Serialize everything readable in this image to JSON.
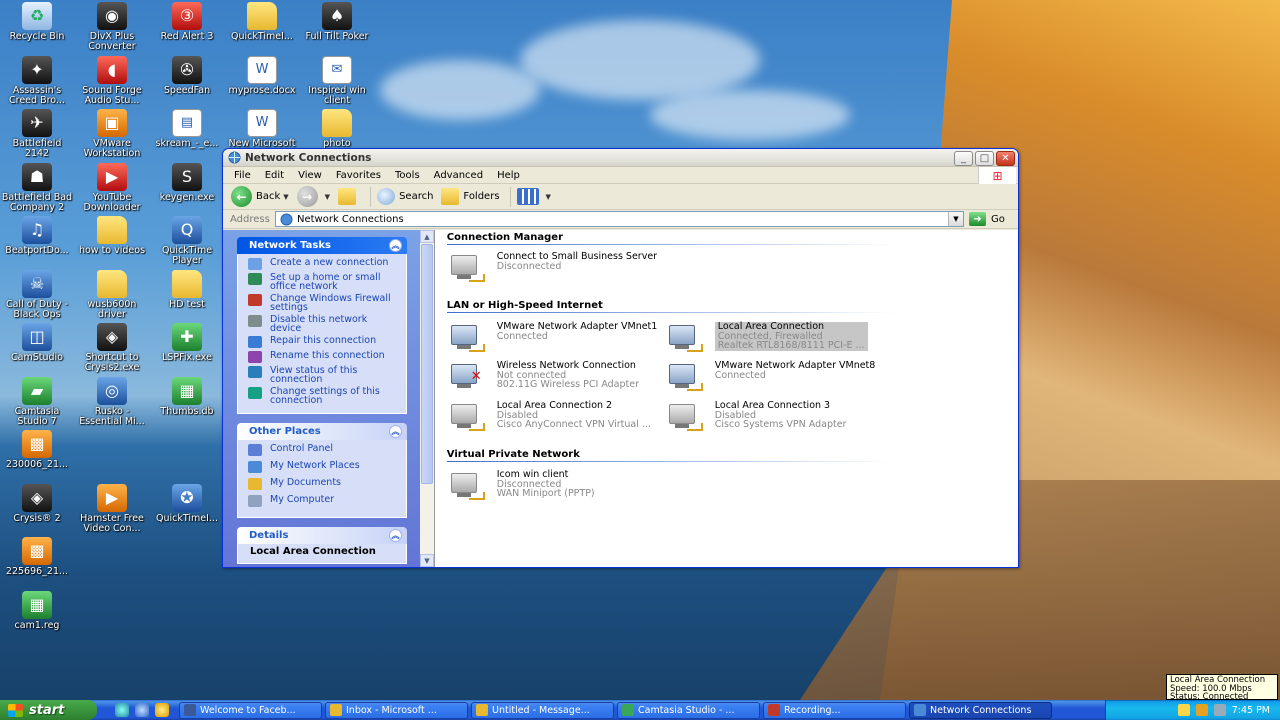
{
  "desktop_icons": [
    {
      "label": "Recycle Bin",
      "style": "recycle",
      "glyph": "♻"
    },
    {
      "label": "DivX Plus Converter",
      "style": "dark",
      "glyph": "◉"
    },
    {
      "label": "Red Alert 3",
      "style": "red",
      "glyph": "③"
    },
    {
      "label": "QuickTimeI...",
      "style": "folder",
      "glyph": ""
    },
    {
      "label": "Full Tilt Poker",
      "style": "dark",
      "glyph": "♠"
    },
    {
      "label": "Assassin's Creed Bro...",
      "style": "dark",
      "glyph": "✦"
    },
    {
      "label": "Sound Forge Audio Stu...",
      "style": "red",
      "glyph": "◖"
    },
    {
      "label": "SpeedFan",
      "style": "dark",
      "glyph": "✇"
    },
    {
      "label": "myprose.docx",
      "style": "doc",
      "glyph": "W"
    },
    {
      "label": "Inspired win client",
      "style": "doc",
      "glyph": "✉"
    },
    {
      "label": "Battlefield 2142",
      "style": "dark",
      "glyph": "✈"
    },
    {
      "label": "VMware Workstation",
      "style": "orange",
      "glyph": "▣"
    },
    {
      "label": "skream_-_e...",
      "style": "doc",
      "glyph": "▤"
    },
    {
      "label": "New Microsoft Office Wo...",
      "style": "doc",
      "glyph": "W"
    },
    {
      "label": "photo",
      "style": "folder",
      "glyph": ""
    },
    {
      "label": "Battlefield Bad Company 2",
      "style": "dark",
      "glyph": "☗"
    },
    {
      "label": "YouTube Downloader",
      "style": "red",
      "glyph": "▶"
    },
    {
      "label": "keygen.exe",
      "style": "dark",
      "glyph": "S"
    },
    {
      "label": "BeatportDo...",
      "style": "app",
      "glyph": "♫"
    },
    {
      "label": "how to videos",
      "style": "folder",
      "glyph": ""
    },
    {
      "label": "QuickTime Player",
      "style": "app",
      "glyph": "Q"
    },
    {
      "label": "Call of Duty - Black Ops",
      "style": "app",
      "glyph": "☠"
    },
    {
      "label": "wusb600n driver",
      "style": "folder",
      "glyph": ""
    },
    {
      "label": "HD test",
      "style": "folder",
      "glyph": ""
    },
    {
      "label": "CamStudio",
      "style": "app",
      "glyph": "◫"
    },
    {
      "label": "Shortcut to Crysis2.exe",
      "style": "dark",
      "glyph": "◈"
    },
    {
      "label": "LSPFix.exe",
      "style": "green",
      "glyph": "✚"
    },
    {
      "label": "Camtasia Studio 7",
      "style": "green",
      "glyph": "▰"
    },
    {
      "label": "Rusko - Essential Mi...",
      "style": "app",
      "glyph": "◎"
    },
    {
      "label": "Thumbs.db",
      "style": "green",
      "glyph": "▦"
    },
    {
      "label": "230006_21...",
      "style": "orange",
      "glyph": "▩"
    },
    {
      "label": "Crysis® 2",
      "style": "dark",
      "glyph": "◈"
    },
    {
      "label": "Hamster Free Video Con...",
      "style": "orange",
      "glyph": "▶"
    },
    {
      "label": "QuickTimeI...",
      "style": "app",
      "glyph": "✪"
    },
    {
      "label": "225696_21...",
      "style": "orange",
      "glyph": "▩"
    },
    {
      "label": "cam1.reg",
      "style": "green",
      "glyph": "▦"
    }
  ],
  "window": {
    "title": "Network Connections",
    "menu": [
      "File",
      "Edit",
      "View",
      "Favorites",
      "Tools",
      "Advanced",
      "Help"
    ],
    "toolbar": {
      "back": "Back",
      "search": "Search",
      "folders": "Folders"
    },
    "address": {
      "label": "Address",
      "value": "Network Connections",
      "go": "Go"
    },
    "network_tasks": {
      "title": "Network Tasks",
      "items": [
        "Create a new connection",
        "Set up a home or small office network",
        "Change Windows Firewall settings",
        "Disable this network device",
        "Repair this connection",
        "Rename this connection",
        "View status of this connection",
        "Change settings of this connection"
      ]
    },
    "other_places": {
      "title": "Other Places",
      "items": [
        "Control Panel",
        "My Network Places",
        "My Documents",
        "My Computer"
      ]
    },
    "details": {
      "title": "Details",
      "value": "Local Area Connection"
    },
    "groups": [
      {
        "title": "Connection Manager"
      },
      {
        "title": "LAN or High-Speed Internet"
      },
      {
        "title": "Virtual Private Network"
      }
    ],
    "connections": [
      {
        "name": "Connect to Small Business Server",
        "status": "Disconnected",
        "device": ""
      },
      {
        "name": "VMware Network Adapter VMnet1",
        "status": "Connected",
        "device": ""
      },
      {
        "name": "Local Area Connection",
        "status": "Connected, Firewalled",
        "device": "Realtek RTL8168/8111 PCI-E ..."
      },
      {
        "name": "Wireless Network Connection",
        "status": "Not connected",
        "device": "802.11G Wireless PCI Adapter"
      },
      {
        "name": "VMware Network Adapter VMnet8",
        "status": "Connected",
        "device": ""
      },
      {
        "name": "Local Area Connection 2",
        "status": "Disabled",
        "device": "Cisco AnyConnect VPN Virtual ..."
      },
      {
        "name": "Local Area Connection 3",
        "status": "Disabled",
        "device": "Cisco Systems VPN Adapter"
      },
      {
        "name": "Icom win client",
        "status": "Disconnected",
        "device": "WAN Miniport (PPTP)"
      }
    ]
  },
  "taskbar": {
    "start": "start",
    "buttons": [
      "Welcome to Faceb...",
      "Inbox - Microsoft ...",
      "Untitled - Message...",
      "Camtasia Studio - ...",
      "Recording...",
      "Network Connections"
    ],
    "clock": "7:45 PM"
  },
  "tooltip": {
    "line1": "Local Area Connection",
    "line2": "Speed: 100.0 Mbps",
    "line3": "Status: Connected"
  }
}
